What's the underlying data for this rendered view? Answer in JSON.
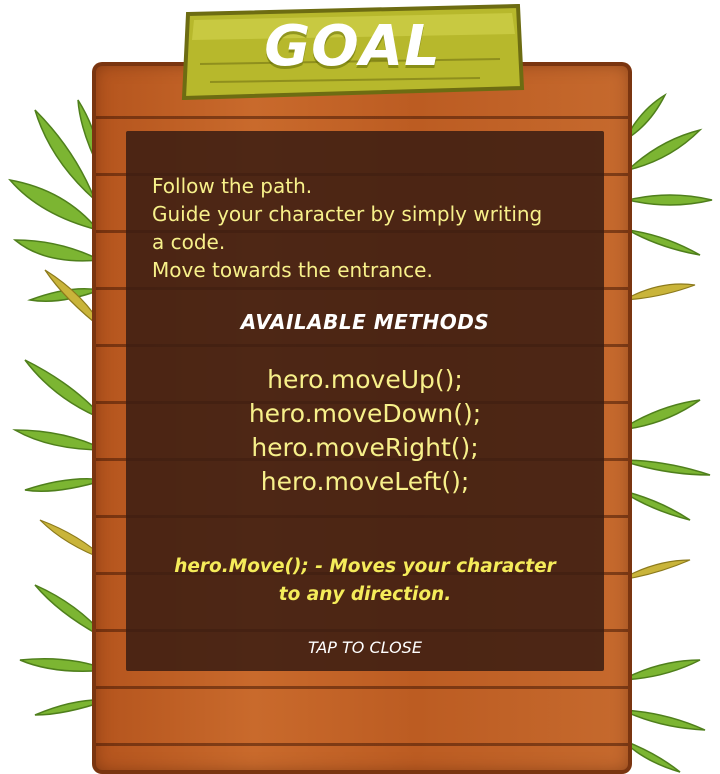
{
  "header": {
    "title": "GOAL"
  },
  "goal": {
    "description": [
      "Follow the path.",
      "Guide your character by simply writing",
      "a code.",
      "Move towards the entrance."
    ]
  },
  "methods": {
    "title": "AVAILABLE METHODS",
    "items": [
      "hero.moveUp();",
      "hero.moveDown();",
      "hero.moveRight();",
      "hero.moveLeft();"
    ]
  },
  "note": {
    "lines": [
      "hero.Move(); - Moves your character",
      "to any direction."
    ]
  },
  "actions": {
    "close_label": "TAP TO CLOSE"
  },
  "colors": {
    "board_wood": "#c0621f",
    "sign_green": "#b7b82c",
    "panel": "#3c1e12",
    "text_yellow": "#f7f08a",
    "leaf_green": "#7cb532"
  }
}
